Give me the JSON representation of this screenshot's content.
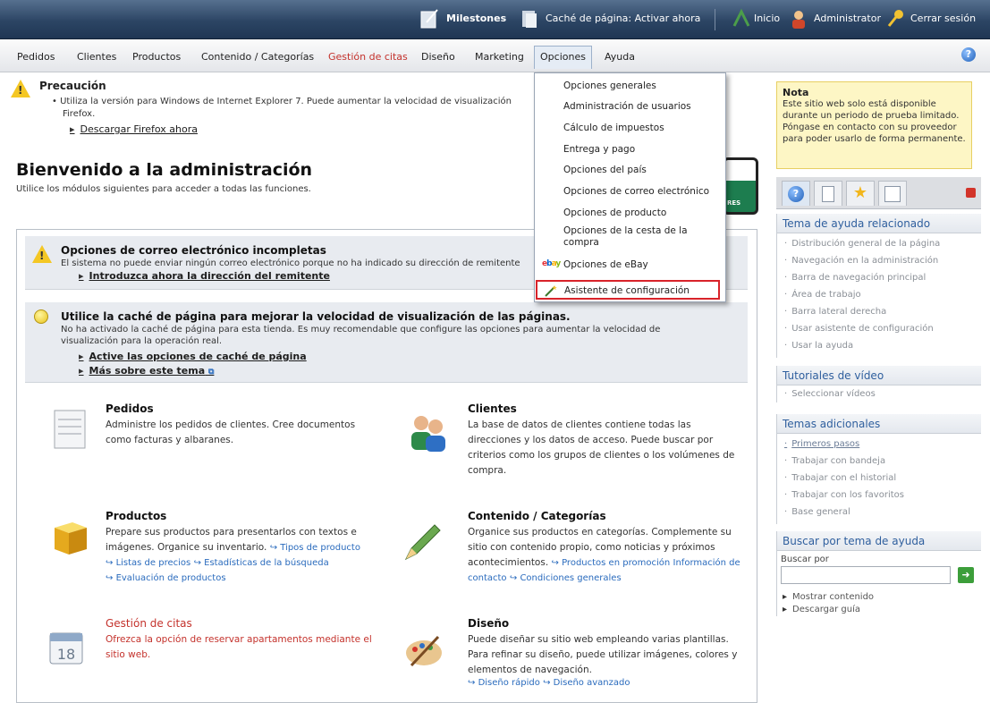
{
  "topbar": {
    "milestones": "Milestones",
    "cache": "Caché de página: Activar ahora",
    "home": "Inicio",
    "admin": "Administrator",
    "logout": "Cerrar sesión"
  },
  "menu": [
    "Pedidos",
    "Clientes",
    "Productos",
    "Contenido / Categorías",
    "Gestión de citas",
    "Diseño",
    "Marketing",
    "Opciones",
    "Ayuda"
  ],
  "warning": {
    "title": "Precaución",
    "text": "Utiliza la versión para Windows de Internet Explorer 7. Puede aumentar la velocidad de visualización",
    "text2": "Firefox.",
    "link": "Descargar Firefox ahora"
  },
  "header": {
    "title": "Bienvenido a la administración",
    "subtitle": "Utilice los módulos siguientes para acceder a todas las funciones."
  },
  "notice_email": {
    "title": "Opciones de correo electrónico incompletas",
    "text": "El sistema no puede enviar ningún correo electrónico porque no ha indicado su dirección de remitente",
    "link": "Introduzca ahora la dirección del remitente"
  },
  "notice_cache": {
    "title": "Utilice la caché de página para mejorar la velocidad de visualización de las páginas.",
    "text": "No ha activado la caché de página para esta tienda. Es muy recomendable que configure las opciones para aumentar la velocidad de visualización para la operación real.",
    "link1": "Active las opciones de caché de página",
    "link2": "Más sobre este tema"
  },
  "modules": {
    "pedidos": {
      "title": "Pedidos",
      "desc": "Administre los pedidos de clientes. Cree documentos como facturas y albaranes."
    },
    "clientes": {
      "title": "Clientes",
      "desc": "La base de datos de clientes contiene todas las direcciones y los datos de acceso. Puede buscar por criterios como los grupos de clientes o los volúmenes de compra."
    },
    "productos": {
      "title": "Productos",
      "desc": "Prepare sus productos para presentarlos con textos e imágenes. Organice su inventario.",
      "link1": "Tipos de producto",
      "link2": "Listas de precios",
      "link3": "Estadísticas de la búsqueda",
      "link4": "Evaluación de productos"
    },
    "contenido": {
      "title": "Contenido / Categorías",
      "desc": "Organice sus productos en categorías. Complemente su sitio con contenido propio, como noticias y próximos acontecimientos.",
      "link1": "Productos en promoción",
      "link2": "Información de contacto",
      "link3": "Condiciones generales"
    },
    "citas": {
      "title": "Gestión de citas",
      "desc": "Ofrezca la opción de reservar apartamentos mediante el sitio web."
    },
    "diseno": {
      "title": "Diseño",
      "desc": "Puede diseñar su sitio web empleando varias plantillas. Para refinar su diseño, puede utilizar imágenes, colores y elementos de navegación.",
      "link1": "Diseño rápido",
      "link2": "Diseño avanzado"
    }
  },
  "dropdown": [
    "Opciones generales",
    "Administración de usuarios",
    "Cálculo de impuestos",
    "Entrega y pago",
    "Opciones del país",
    "Opciones de correo electrónico",
    "Opciones de producto",
    "Opciones de la cesta de la compra",
    "Opciones de eBay",
    "Asistente de configuración"
  ],
  "sidebar": {
    "note_title": "Nota",
    "note_text": "Este sitio web solo está disponible durante un periodo de prueba limitado. Póngase en contacto con su proveedor para poder usarlo de forma permanente.",
    "related_title": "Tema de ayuda relacionado",
    "related": [
      "Distribución general de la página",
      "Navegación en la administración",
      "Barra de navegación principal",
      "Área de trabajo",
      "Barra lateral derecha",
      "Usar asistente de configuración",
      "Usar la ayuda"
    ],
    "video_title": "Tutoriales de vídeo",
    "video": [
      "Seleccionar vídeos"
    ],
    "more_title": "Temas adicionales",
    "more": [
      "Primeros pasos",
      "Trabajar con bandeja",
      "Trabajar con el historial",
      "Trabajar con los favoritos",
      "Base general"
    ],
    "search_title": "Buscar por tema de ayuda",
    "search_label": "Buscar por",
    "show": "Mostrar contenido",
    "download": "Descargar guía"
  },
  "colors": {
    "accent_red": "#c4322c",
    "link_blue": "#2a6bbd",
    "topbar": "#2c4564"
  }
}
